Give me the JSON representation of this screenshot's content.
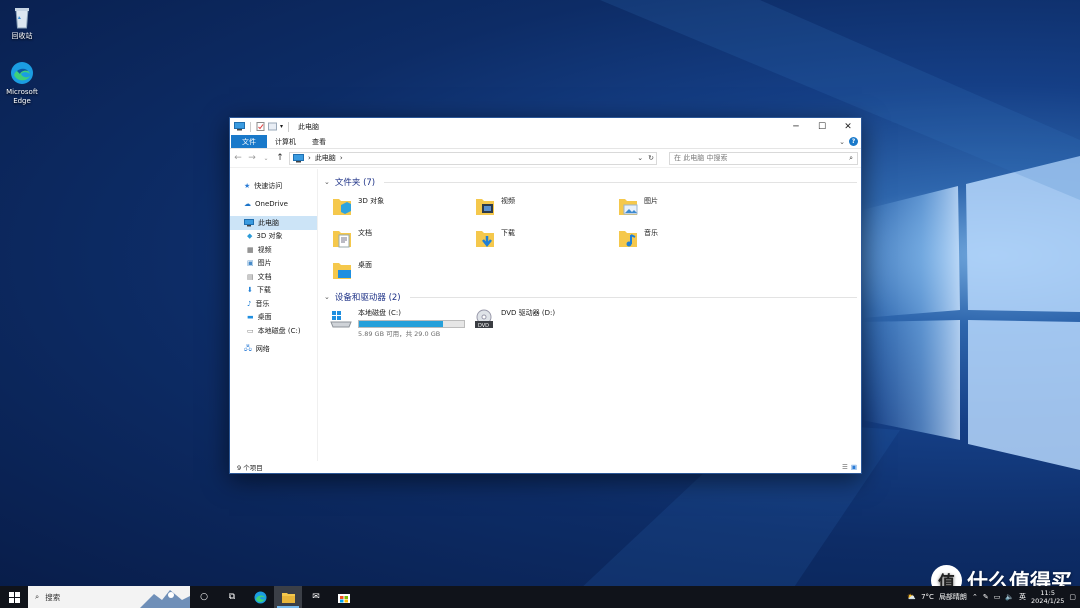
{
  "desktop": {
    "icons": [
      {
        "label": "回收站"
      },
      {
        "label": "Microsoft Edge"
      }
    ]
  },
  "window": {
    "title": "此电脑",
    "ribbon_tabs": [
      "文件",
      "计算机",
      "查看"
    ],
    "address_path": "此电脑",
    "search_placeholder": "在 此电脑 中搜索",
    "nav": {
      "quick_access": "快速访问",
      "onedrive": "OneDrive",
      "this_pc": "此电脑",
      "items": [
        "3D 对象",
        "视频",
        "图片",
        "文档",
        "下载",
        "音乐",
        "桌面",
        "本地磁盘 (C:)"
      ],
      "network": "网络"
    },
    "folders_group": "文件夹 (7)",
    "folders": [
      "3D 对象",
      "视频",
      "图片",
      "文档",
      "下载",
      "音乐",
      "桌面"
    ],
    "devices_group": "设备和驱动器 (2)",
    "drives": [
      {
        "name": "本地磁盘 (C:)",
        "usage": "5.89 GB 可用，共 29.0 GB",
        "used_fraction": 0.8
      },
      {
        "name": "DVD 驱动器 (D:)"
      }
    ],
    "status": "9 个项目"
  },
  "taskbar": {
    "search_placeholder": "搜索",
    "weather": "7°C",
    "weather_text": "局部晴朗",
    "ime": "英",
    "time": "11:5",
    "date": "2024/1/25"
  },
  "watermark": {
    "logo": "值",
    "text": "什么值得买"
  },
  "colors": {
    "accent": "#1979ca",
    "selection": "#cce4f7",
    "drive_bar": "#26a0da",
    "taskbar": "#10131a"
  }
}
